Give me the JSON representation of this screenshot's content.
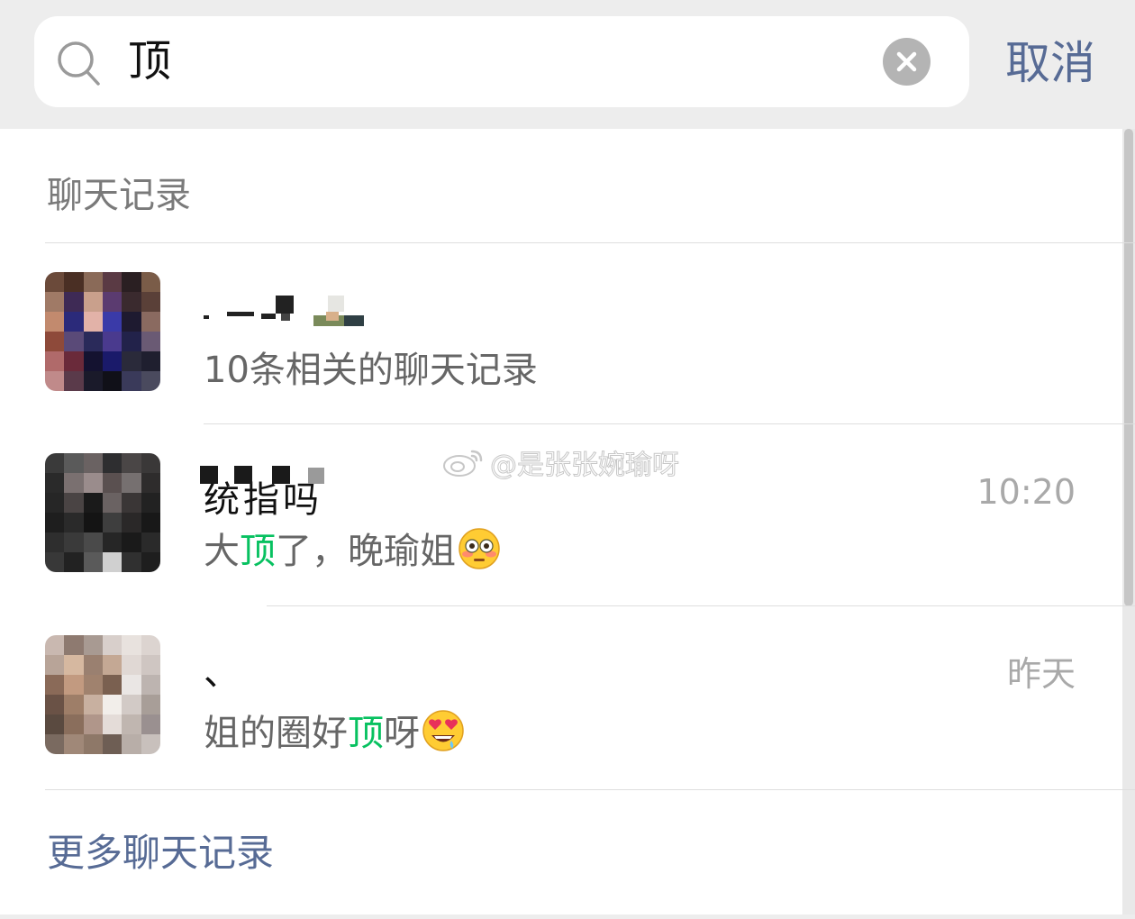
{
  "search": {
    "query": "顶",
    "cancel_label": "取消"
  },
  "section": {
    "title": "聊天记录"
  },
  "results": [
    {
      "name": "",
      "subtitle": "10条相关的聊天记录",
      "time": ""
    },
    {
      "name": "统指吗",
      "subtitle_before": "大",
      "keyword": "顶",
      "subtitle_after": "了，晚瑜姐",
      "emoji": "flushed-face-emoji",
      "time": "10:20"
    },
    {
      "name": "、",
      "subtitle_before": "姐的圈好",
      "keyword": "顶",
      "subtitle_after": "呀",
      "emoji": "star-struck-emoji",
      "time": "昨天"
    }
  ],
  "more_link": "更多聊天记录",
  "watermark": "@是张张婉瑜呀",
  "colors": {
    "accent_link": "#576b95",
    "highlight": "#07c160",
    "page_bg": "#ededed"
  }
}
